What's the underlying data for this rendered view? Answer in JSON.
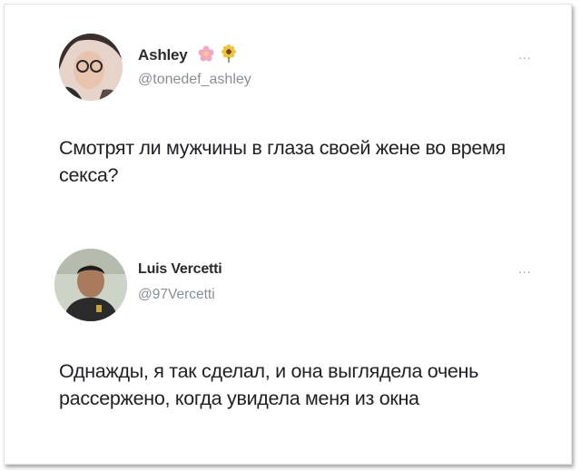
{
  "tweets": [
    {
      "name": "Ashley",
      "handle": "@tonedef_ashley",
      "text": "Смотрят ли мужчины в глаза своей жене во время секса?",
      "more": "...",
      "name_emojis": [
        "flower-emoji",
        "sunflower-emoji"
      ]
    },
    {
      "name": "Luis Vercetti",
      "handle": "@97Vercetti",
      "text": "Однажды, я так сделал, и она выглядела очень рассержено, когда увидела меня из окна",
      "more": "..."
    }
  ],
  "colors": {
    "name": "#2b2b2b",
    "handle": "#8a8f94",
    "text": "#202124",
    "background": "#ffffff"
  }
}
